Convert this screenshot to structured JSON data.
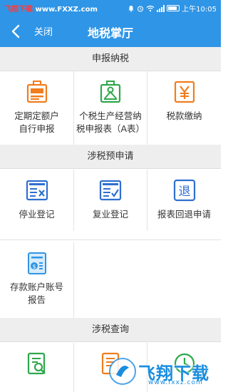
{
  "status_bar": {
    "watermark_prefix": "飞翔下载",
    "watermark_url": "www.FXXZ.com",
    "time_text": "上午10:05",
    "icons": [
      "bell-icon",
      "alarm-icon",
      "wifi-icon",
      "signal-icon",
      "battery-icon"
    ]
  },
  "nav": {
    "back_icon": "chevron-left-icon",
    "close_label": "关闭",
    "title": "地税掌厅"
  },
  "sections": [
    {
      "title": "申报纳税",
      "items": [
        {
          "icon": "id-badge-icon",
          "label_line1": "定期定额户",
          "label_line2": "自行申报"
        },
        {
          "icon": "document-person-icon",
          "label_line1": "个税生产经营纳",
          "label_line2": "税申报表（A表）"
        },
        {
          "icon": "yen-icon",
          "label_line1": "税款缴纳",
          "label_line2": ""
        }
      ]
    },
    {
      "title": "涉税预申请",
      "items": [
        {
          "icon": "form-cancel-icon",
          "label_line1": "停业登记",
          "label_line2": ""
        },
        {
          "icon": "form-check-icon",
          "label_line1": "复业登记",
          "label_line2": ""
        },
        {
          "icon": "refund-icon",
          "label_line1": "报表回退申请",
          "label_line2": ""
        },
        {
          "icon": "bank-account-icon",
          "label_line1": "存款账户账号",
          "label_line2": "报告"
        }
      ]
    },
    {
      "title": "涉税查询",
      "items": [
        {
          "icon": "doc-search-icon",
          "label_line1": "",
          "label_line2": ""
        },
        {
          "icon": "ledger-icon",
          "label_line1": "",
          "label_line2": ""
        },
        {
          "icon": "clock-icon",
          "label_line1": "",
          "label_line2": ""
        }
      ]
    }
  ],
  "overlay_watermark": {
    "text": "飞翔下载",
    "url": "www.fxxz.com"
  },
  "colors": {
    "accent": "#2f95e6",
    "orange": "#f07d1e",
    "green": "#2da84b",
    "blue": "#2f6fd0",
    "section_bg": "#eeeeee"
  }
}
